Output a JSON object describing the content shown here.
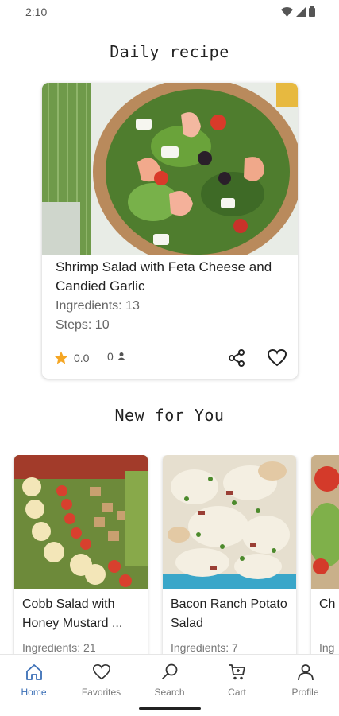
{
  "status": {
    "time": "2:10"
  },
  "daily": {
    "title": "Daily recipe",
    "recipe_name": "Shrimp Salad with Feta Cheese and Candied Garlic",
    "ingredients": "Ingredients: 13",
    "steps": "Steps: 10",
    "rating": "0.0",
    "reviews": "0"
  },
  "new_for_you": {
    "title": "New for You",
    "cards": [
      {
        "name": "Cobb Salad with Honey Mustard ...",
        "ingredients": "Ingredients: 21"
      },
      {
        "name": "Bacon Ranch Potato Salad",
        "ingredients": "Ingredients: 7"
      },
      {
        "name": "Ch",
        "ingredients": "Ing"
      }
    ]
  },
  "nav": {
    "items": [
      {
        "label": "Home",
        "icon": "home-icon",
        "active": true
      },
      {
        "label": "Favorites",
        "icon": "heart-icon"
      },
      {
        "label": "Search",
        "icon": "search-icon"
      },
      {
        "label": "Cart",
        "icon": "cart-icon"
      },
      {
        "label": "Profile",
        "icon": "person-icon"
      }
    ]
  },
  "colors": {
    "accent": "#3b6fb6",
    "star": "#f5a623",
    "text": "#222222",
    "muted": "#777777"
  }
}
